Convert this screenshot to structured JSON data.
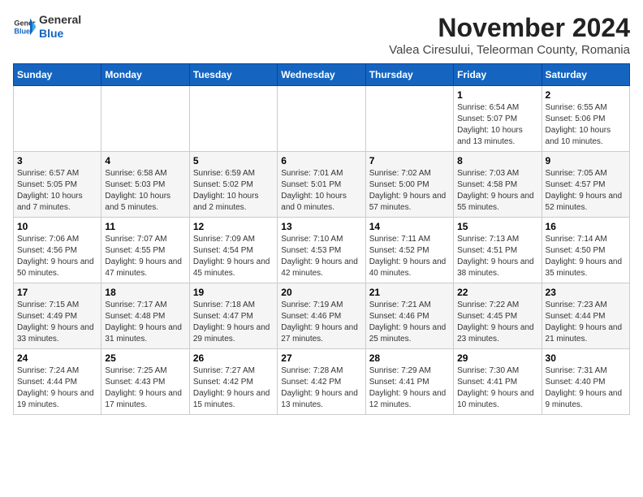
{
  "header": {
    "logo_general": "General",
    "logo_blue": "Blue",
    "month_title": "November 2024",
    "location": "Valea Ciresului, Teleorman County, Romania"
  },
  "weekdays": [
    "Sunday",
    "Monday",
    "Tuesday",
    "Wednesday",
    "Thursday",
    "Friday",
    "Saturday"
  ],
  "weeks": [
    [
      {
        "day": "",
        "info": ""
      },
      {
        "day": "",
        "info": ""
      },
      {
        "day": "",
        "info": ""
      },
      {
        "day": "",
        "info": ""
      },
      {
        "day": "",
        "info": ""
      },
      {
        "day": "1",
        "info": "Sunrise: 6:54 AM\nSunset: 5:07 PM\nDaylight: 10 hours and 13 minutes."
      },
      {
        "day": "2",
        "info": "Sunrise: 6:55 AM\nSunset: 5:06 PM\nDaylight: 10 hours and 10 minutes."
      }
    ],
    [
      {
        "day": "3",
        "info": "Sunrise: 6:57 AM\nSunset: 5:05 PM\nDaylight: 10 hours and 7 minutes."
      },
      {
        "day": "4",
        "info": "Sunrise: 6:58 AM\nSunset: 5:03 PM\nDaylight: 10 hours and 5 minutes."
      },
      {
        "day": "5",
        "info": "Sunrise: 6:59 AM\nSunset: 5:02 PM\nDaylight: 10 hours and 2 minutes."
      },
      {
        "day": "6",
        "info": "Sunrise: 7:01 AM\nSunset: 5:01 PM\nDaylight: 10 hours and 0 minutes."
      },
      {
        "day": "7",
        "info": "Sunrise: 7:02 AM\nSunset: 5:00 PM\nDaylight: 9 hours and 57 minutes."
      },
      {
        "day": "8",
        "info": "Sunrise: 7:03 AM\nSunset: 4:58 PM\nDaylight: 9 hours and 55 minutes."
      },
      {
        "day": "9",
        "info": "Sunrise: 7:05 AM\nSunset: 4:57 PM\nDaylight: 9 hours and 52 minutes."
      }
    ],
    [
      {
        "day": "10",
        "info": "Sunrise: 7:06 AM\nSunset: 4:56 PM\nDaylight: 9 hours and 50 minutes."
      },
      {
        "day": "11",
        "info": "Sunrise: 7:07 AM\nSunset: 4:55 PM\nDaylight: 9 hours and 47 minutes."
      },
      {
        "day": "12",
        "info": "Sunrise: 7:09 AM\nSunset: 4:54 PM\nDaylight: 9 hours and 45 minutes."
      },
      {
        "day": "13",
        "info": "Sunrise: 7:10 AM\nSunset: 4:53 PM\nDaylight: 9 hours and 42 minutes."
      },
      {
        "day": "14",
        "info": "Sunrise: 7:11 AM\nSunset: 4:52 PM\nDaylight: 9 hours and 40 minutes."
      },
      {
        "day": "15",
        "info": "Sunrise: 7:13 AM\nSunset: 4:51 PM\nDaylight: 9 hours and 38 minutes."
      },
      {
        "day": "16",
        "info": "Sunrise: 7:14 AM\nSunset: 4:50 PM\nDaylight: 9 hours and 35 minutes."
      }
    ],
    [
      {
        "day": "17",
        "info": "Sunrise: 7:15 AM\nSunset: 4:49 PM\nDaylight: 9 hours and 33 minutes."
      },
      {
        "day": "18",
        "info": "Sunrise: 7:17 AM\nSunset: 4:48 PM\nDaylight: 9 hours and 31 minutes."
      },
      {
        "day": "19",
        "info": "Sunrise: 7:18 AM\nSunset: 4:47 PM\nDaylight: 9 hours and 29 minutes."
      },
      {
        "day": "20",
        "info": "Sunrise: 7:19 AM\nSunset: 4:46 PM\nDaylight: 9 hours and 27 minutes."
      },
      {
        "day": "21",
        "info": "Sunrise: 7:21 AM\nSunset: 4:46 PM\nDaylight: 9 hours and 25 minutes."
      },
      {
        "day": "22",
        "info": "Sunrise: 7:22 AM\nSunset: 4:45 PM\nDaylight: 9 hours and 23 minutes."
      },
      {
        "day": "23",
        "info": "Sunrise: 7:23 AM\nSunset: 4:44 PM\nDaylight: 9 hours and 21 minutes."
      }
    ],
    [
      {
        "day": "24",
        "info": "Sunrise: 7:24 AM\nSunset: 4:44 PM\nDaylight: 9 hours and 19 minutes."
      },
      {
        "day": "25",
        "info": "Sunrise: 7:25 AM\nSunset: 4:43 PM\nDaylight: 9 hours and 17 minutes."
      },
      {
        "day": "26",
        "info": "Sunrise: 7:27 AM\nSunset: 4:42 PM\nDaylight: 9 hours and 15 minutes."
      },
      {
        "day": "27",
        "info": "Sunrise: 7:28 AM\nSunset: 4:42 PM\nDaylight: 9 hours and 13 minutes."
      },
      {
        "day": "28",
        "info": "Sunrise: 7:29 AM\nSunset: 4:41 PM\nDaylight: 9 hours and 12 minutes."
      },
      {
        "day": "29",
        "info": "Sunrise: 7:30 AM\nSunset: 4:41 PM\nDaylight: 9 hours and 10 minutes."
      },
      {
        "day": "30",
        "info": "Sunrise: 7:31 AM\nSunset: 4:40 PM\nDaylight: 9 hours and 9 minutes."
      }
    ]
  ]
}
